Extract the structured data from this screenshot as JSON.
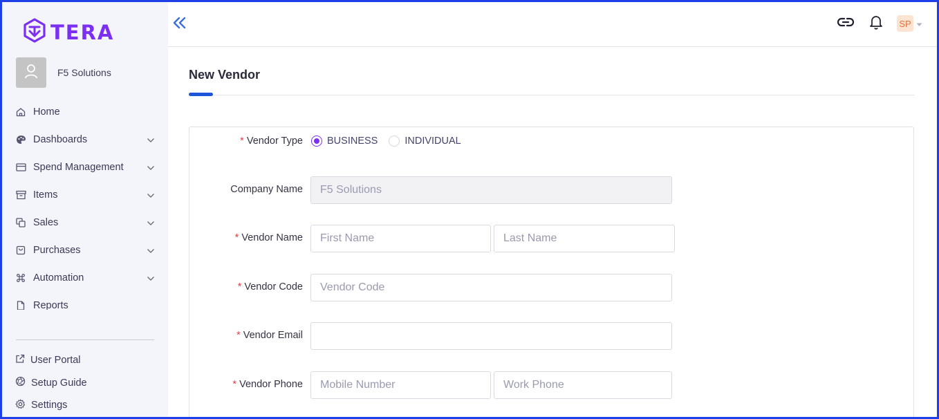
{
  "app": {
    "logo_text": "TERA",
    "org_name": "F5 Solutions",
    "brand_color": "#7b2ff0"
  },
  "sidebar": {
    "items": [
      {
        "label": "Home",
        "icon": "home-icon",
        "has_submenu": false
      },
      {
        "label": "Dashboards",
        "icon": "palette-icon",
        "has_submenu": true
      },
      {
        "label": "Spend Management",
        "icon": "credit-card-icon",
        "has_submenu": true
      },
      {
        "label": "Items",
        "icon": "archive-icon",
        "has_submenu": true
      },
      {
        "label": "Sales",
        "icon": "copy-icon",
        "has_submenu": true
      },
      {
        "label": "Purchases",
        "icon": "shopping-bag-icon",
        "has_submenu": true
      },
      {
        "label": "Automation",
        "icon": "command-icon",
        "has_submenu": true
      },
      {
        "label": "Reports",
        "icon": "file-icon",
        "has_submenu": false
      }
    ],
    "bottom_items": [
      {
        "label": "User Portal",
        "icon": "external-link-icon"
      },
      {
        "label": "Setup Guide",
        "icon": "aperture-icon"
      },
      {
        "label": "Settings",
        "icon": "gear-icon"
      }
    ]
  },
  "topbar": {
    "user_initials": "SP"
  },
  "page": {
    "title": "New Vendor"
  },
  "form": {
    "vendor_type": {
      "label": "Vendor Type",
      "required": true,
      "options": [
        "BUSINESS",
        "INDIVIDUAL"
      ],
      "selected": "BUSINESS"
    },
    "company_name": {
      "label": "Company Name",
      "value": "F5 Solutions",
      "disabled": true
    },
    "vendor_name": {
      "label": "Vendor Name",
      "required": true,
      "first_placeholder": "First Name",
      "last_placeholder": "Last Name"
    },
    "vendor_code": {
      "label": "Vendor Code",
      "required": true,
      "placeholder": "Vendor Code"
    },
    "vendor_email": {
      "label": "Vendor Email",
      "required": true,
      "placeholder": ""
    },
    "vendor_phone": {
      "label": "Vendor Phone",
      "required": true,
      "mobile_placeholder": "Mobile Number",
      "work_placeholder": "Work Phone"
    },
    "required_marker": "*"
  }
}
